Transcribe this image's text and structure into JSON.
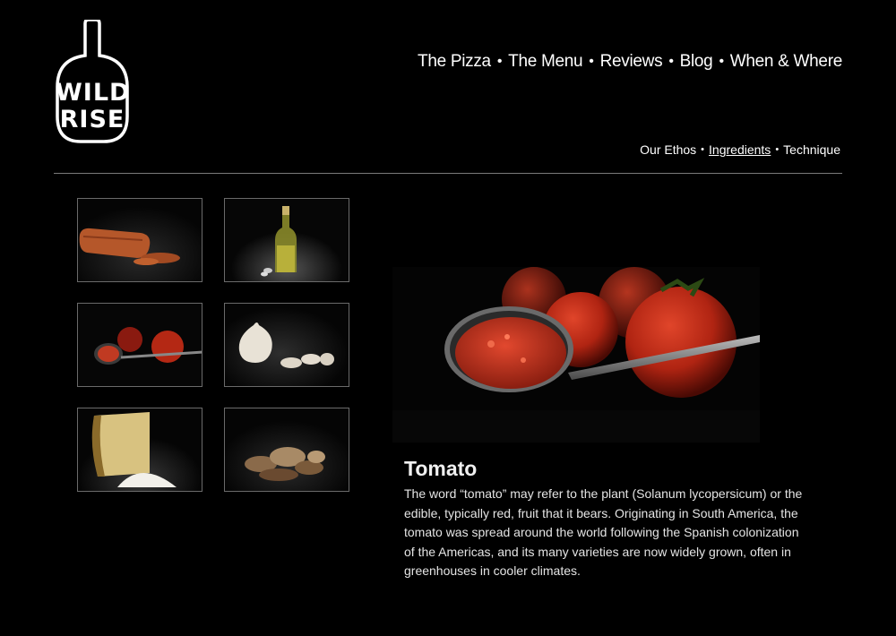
{
  "logo": {
    "line1": "WILD",
    "line2": "RISE"
  },
  "nav": {
    "items": [
      {
        "label": "The Pizza"
      },
      {
        "label": "The Menu"
      },
      {
        "label": "Reviews"
      },
      {
        "label": "Blog"
      },
      {
        "label": "When & Where"
      }
    ],
    "separator": "•"
  },
  "subnav": {
    "items": [
      {
        "label": "Our Ethos",
        "active": false
      },
      {
        "label": "Ingredients",
        "active": true
      },
      {
        "label": "Technique",
        "active": false
      }
    ],
    "separator": "•"
  },
  "thumbnails": [
    {
      "subject": "pepperoni"
    },
    {
      "subject": "olive-oil-bottle"
    },
    {
      "subject": "tomato-sauce-spoon"
    },
    {
      "subject": "garlic"
    },
    {
      "subject": "parmesan-cheese"
    },
    {
      "subject": "mushrooms"
    }
  ],
  "feature": {
    "subject": "tomato-sauce-spoon",
    "title": "Tomato",
    "body": "The word “tomato” may refer to the plant (Solanum lycopersicum) or the edible, typically red, fruit that it bears. Originating in South America, the tomato was spread around the world following the Spanish colonization of the Americas, and its many varieties are now widely grown, often in greenhouses in cooler climates."
  },
  "colors": {
    "background": "#000000",
    "text": "#ffffff",
    "tomato": "#c62a16",
    "divider": "#7a7a7a"
  }
}
